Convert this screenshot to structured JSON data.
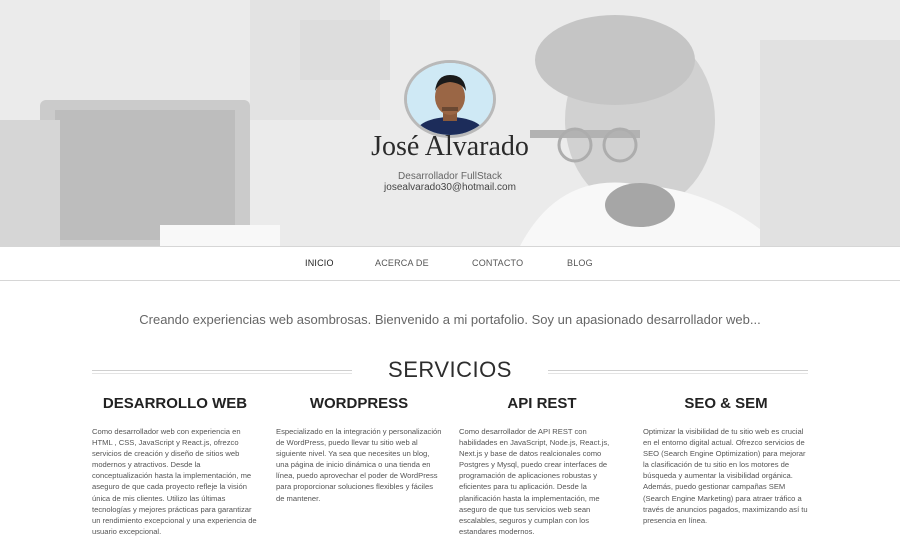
{
  "profile": {
    "name": "José Alvarado",
    "role": "Desarrollador FullStack",
    "email": "josealvarado30@hotmail.com"
  },
  "nav": {
    "items": [
      "INICIO",
      "ACERCA DE",
      "CONTACTO",
      "BLOG"
    ],
    "active": "INICIO"
  },
  "intro": "Creando experiencias web asombrosas. Bienvenido a mi portafolio. Soy un apasionado desarrollador web...",
  "services": {
    "title": "SERVICIOS",
    "items": [
      {
        "title": "DESARROLLO WEB",
        "text": "Como desarrollador web con experiencia en HTML , CSS, JavaScript y React.js, ofrezco servicios de creación y diseño de sitios web modernos y atractivos. Desde la conceptualización hasta la implementación, me aseguro de que cada proyecto refleje la visión única de mis clientes. Utilizo las últimas tecnologías y mejores prácticas para garantizar un rendimiento excepcional y una experiencia de usuario excepcional."
      },
      {
        "title": "WORDPRESS",
        "text": "Especializado en la integración y personalización de WordPress, puedo llevar tu sitio web al siguiente nivel. Ya sea que necesites un blog, una página de inicio dinámica o una tienda en línea, puedo aprovechar el poder de WordPress para proporcionar soluciones flexibles y fáciles de mantener."
      },
      {
        "title": "API REST",
        "text": "Como desarrollador de API REST con habilidades en JavaScript, Node.js, React.js, Next.js y base de datos realcionales como Postgres y Mysql, puedo crear interfaces de programación de aplicaciones robustas y eficientes para tu aplicación. Desde la planificación hasta la implementación, me aseguro de que tus servicios web sean escalables, seguros y cumplan con los estandares modernos."
      },
      {
        "title": "SEO & SEM",
        "text": "Optimizar la visibilidad de tu sitio web es crucial en el entorno digital actual. Ofrezco servicios de SEO (Search Engine Optimization) para mejorar la clasificación de tu sitio en los motores de búsqueda y aumentar la visibilidad orgánica. Además, puedo gestionar campañas SEM (Search Engine Marketing) para atraer tráfico a través de anuncios pagados, maximizando así tu presencia en línea."
      }
    ]
  }
}
